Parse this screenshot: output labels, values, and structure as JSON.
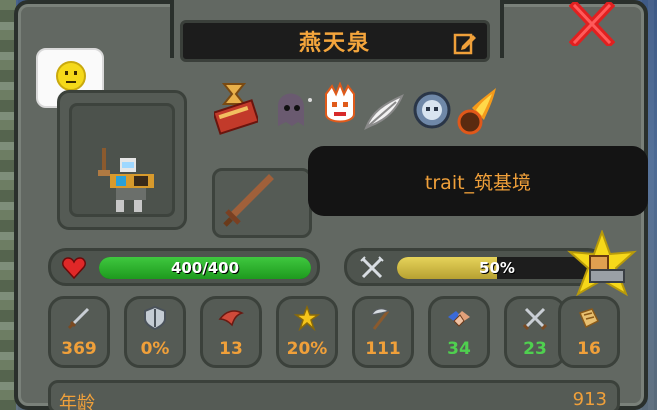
{
  "unit": {
    "name": "燕天泉",
    "tooltip": "trait_筑基境"
  },
  "health": {
    "label": "400/400",
    "current": 400,
    "max": 400,
    "color": "#2fb32f"
  },
  "hunger": {
    "label": "50%",
    "fraction": 0.5,
    "color": "#d4c04a"
  },
  "stats": [
    {
      "icon": "sword-icon",
      "value": "369",
      "color": "#f0a03a"
    },
    {
      "icon": "shield-icon",
      "value": "0%",
      "color": "#f0a03a"
    },
    {
      "icon": "wing-icon",
      "value": "13",
      "color": "#f0a03a"
    },
    {
      "icon": "crit-star-icon",
      "value": "20%",
      "color": "#f0a03a"
    },
    {
      "icon": "scythe-icon",
      "value": "111",
      "color": "#f0a03a"
    },
    {
      "icon": "diplomacy-icon",
      "value": "34",
      "color": "#4fd04f"
    },
    {
      "icon": "warfare-icon",
      "value": "23",
      "color": "#4fd04f"
    },
    {
      "icon": "stewardship-icon",
      "value": "16",
      "color": "#f0a03a"
    }
  ],
  "info": {
    "age_label": "年龄",
    "age_value": "913"
  },
  "traits": [
    "hourglass-book-icon",
    "ghost-icon",
    "fire-face-icon",
    "feather-icon",
    "skull-orb-icon",
    "meteor-icon"
  ],
  "colors": {
    "accent": "#f0a03a",
    "frame": "#626862",
    "close": "#e02020"
  }
}
